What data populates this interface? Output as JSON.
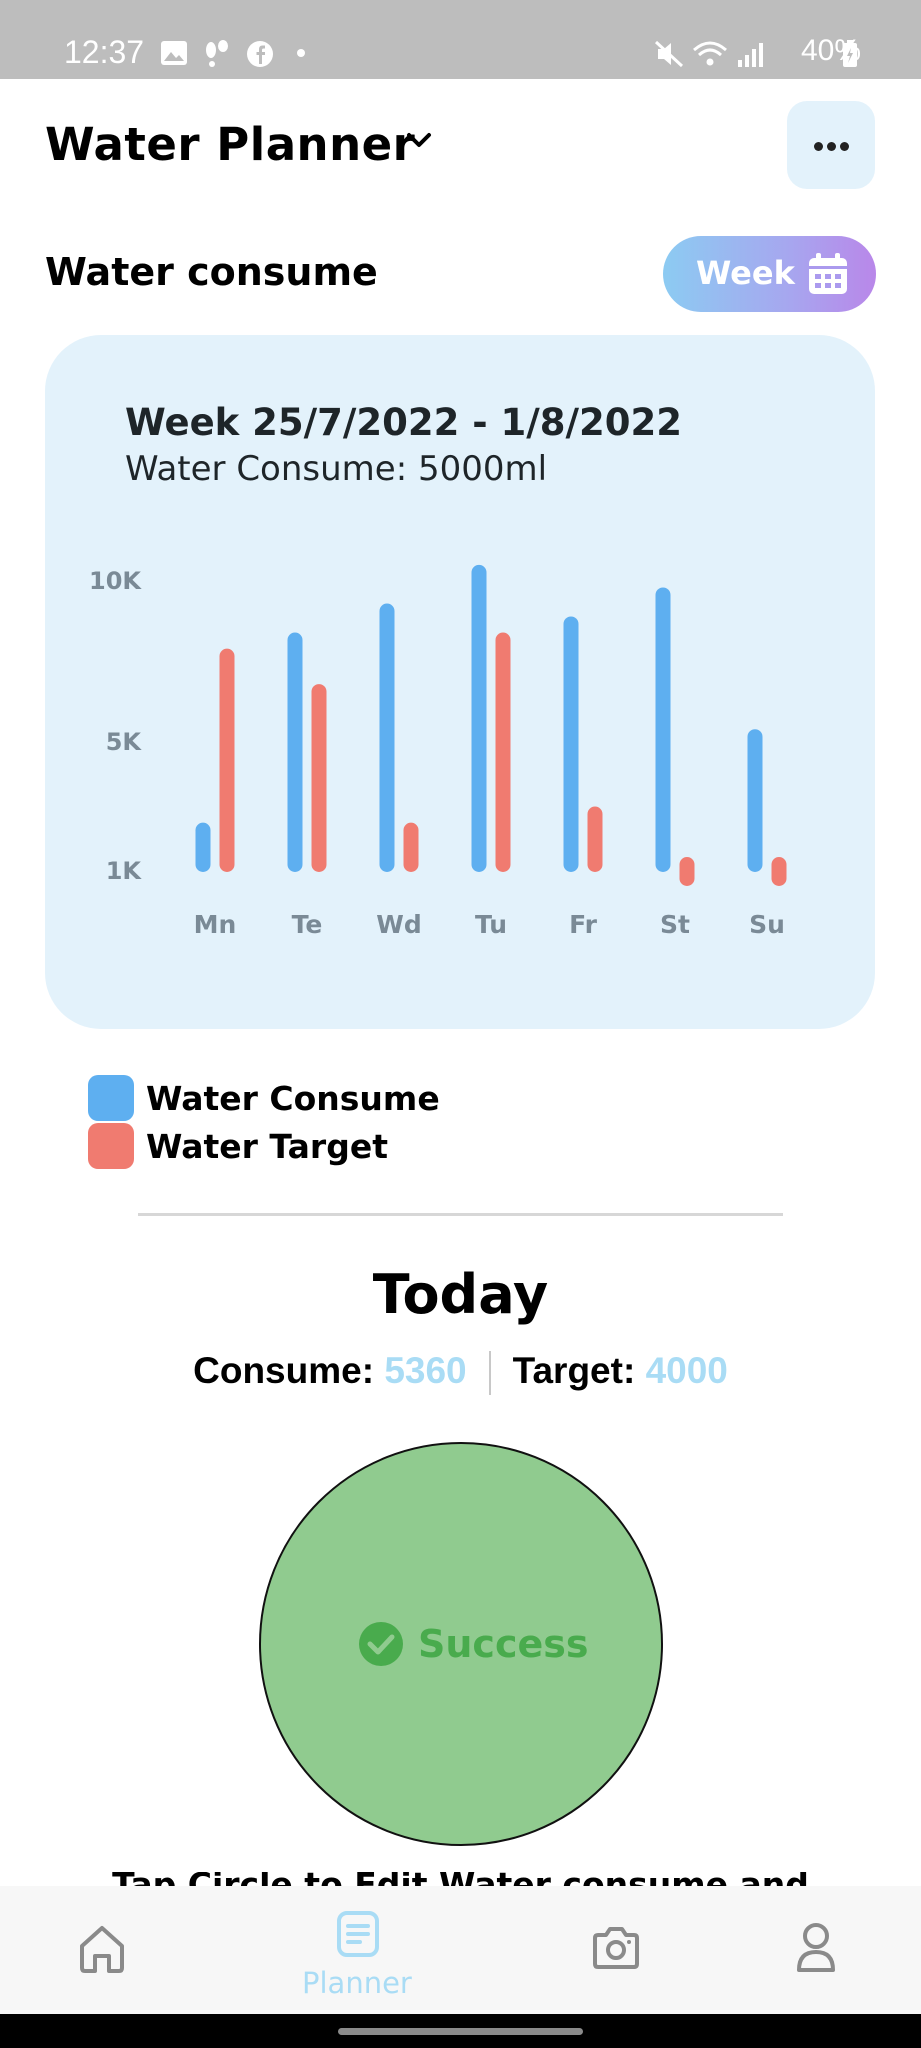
{
  "status_bar": {
    "time": "12:37",
    "battery": "40%"
  },
  "header": {
    "title": "Water Planner"
  },
  "section": {
    "title": "Water consume",
    "period_button": "Week"
  },
  "chart_card": {
    "week_label": "Week 25/7/2022 - 1/8/2022",
    "subtitle": "Water Consume: 5000ml"
  },
  "chart_data": {
    "type": "bar",
    "categories": [
      "Mn",
      "Te",
      "Wd",
      "Tu",
      "Fr",
      "St",
      "Su"
    ],
    "y_ticks": [
      "10K",
      "5K",
      "1K"
    ],
    "ylim": [
      1000,
      10000
    ],
    "series": [
      {
        "name": "Water Consume",
        "color": "#5eaff0",
        "values": [
          2500,
          8400,
          9300,
          10500,
          8900,
          9800,
          5400
        ]
      },
      {
        "name": "Water Target",
        "color": "#f07b70",
        "values": [
          7900,
          6800,
          2500,
          8400,
          3000,
          1000,
          1000
        ]
      }
    ]
  },
  "legend": [
    {
      "label": "Water Consume",
      "color": "#5eaff0"
    },
    {
      "label": "Water Target",
      "color": "#f07b70"
    }
  ],
  "today": {
    "title": "Today",
    "consume_label": "Consume:",
    "consume_value": "5360",
    "target_label": "Target:",
    "target_value": "4000",
    "status": "Success",
    "hint": "Tap Circle to Edit Water consume and"
  },
  "bottom_nav": {
    "active": "Planner",
    "planner_label": "Planner"
  },
  "icons": [
    "image-icon",
    "footsteps-icon",
    "facebook-icon",
    "mute-icon",
    "wifi-icon",
    "signal-icon",
    "battery-icon",
    "chevron-down-icon",
    "more-icon",
    "calendar-icon",
    "check-circle-icon",
    "home-icon",
    "planner-icon",
    "camera-icon",
    "profile-icon"
  ]
}
